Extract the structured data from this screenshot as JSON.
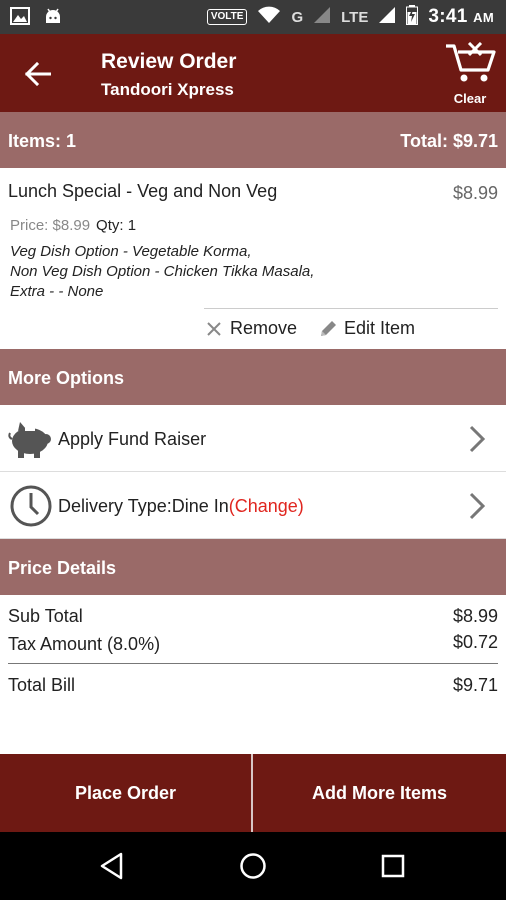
{
  "status_bar": {
    "volte": "VOLTE",
    "network_g": "G",
    "network_lte": "LTE",
    "time": "3:41",
    "ampm": "AM"
  },
  "header": {
    "title": "Review Order",
    "subtitle": "Tandoori Xpress",
    "clear_label": "Clear"
  },
  "summary": {
    "items": "Items: 1",
    "total": "Total: $9.71"
  },
  "item": {
    "name": "Lunch Special - Veg and Non Veg",
    "price": "$8.99",
    "unit_price": "Price: $8.99",
    "qty": "Qty: 1",
    "options": [
      "Veg Dish Option - Vegetable Korma,",
      "Non Veg Dish Option - Chicken Tikka Masala,",
      "Extra - - None"
    ],
    "remove_label": "Remove",
    "edit_label": "Edit Item"
  },
  "more_options": {
    "title": "More Options",
    "fund_raiser": "Apply Fund Raiser",
    "delivery_type": "Delivery Type:Dine In",
    "change": "(Change)"
  },
  "price_details": {
    "title": "Price Details",
    "sub_total_label": "Sub Total",
    "sub_total": "$8.99",
    "tax_label": "Tax Amount (8.0%)",
    "tax": "$0.72",
    "total_label": "Total Bill",
    "total": "$9.71"
  },
  "actions": {
    "place_order": "Place Order",
    "add_more": "Add More Items"
  },
  "colors": {
    "app_bar": "#6e1913",
    "section_header": "#9a6a68",
    "change_link": "#e0261f"
  }
}
